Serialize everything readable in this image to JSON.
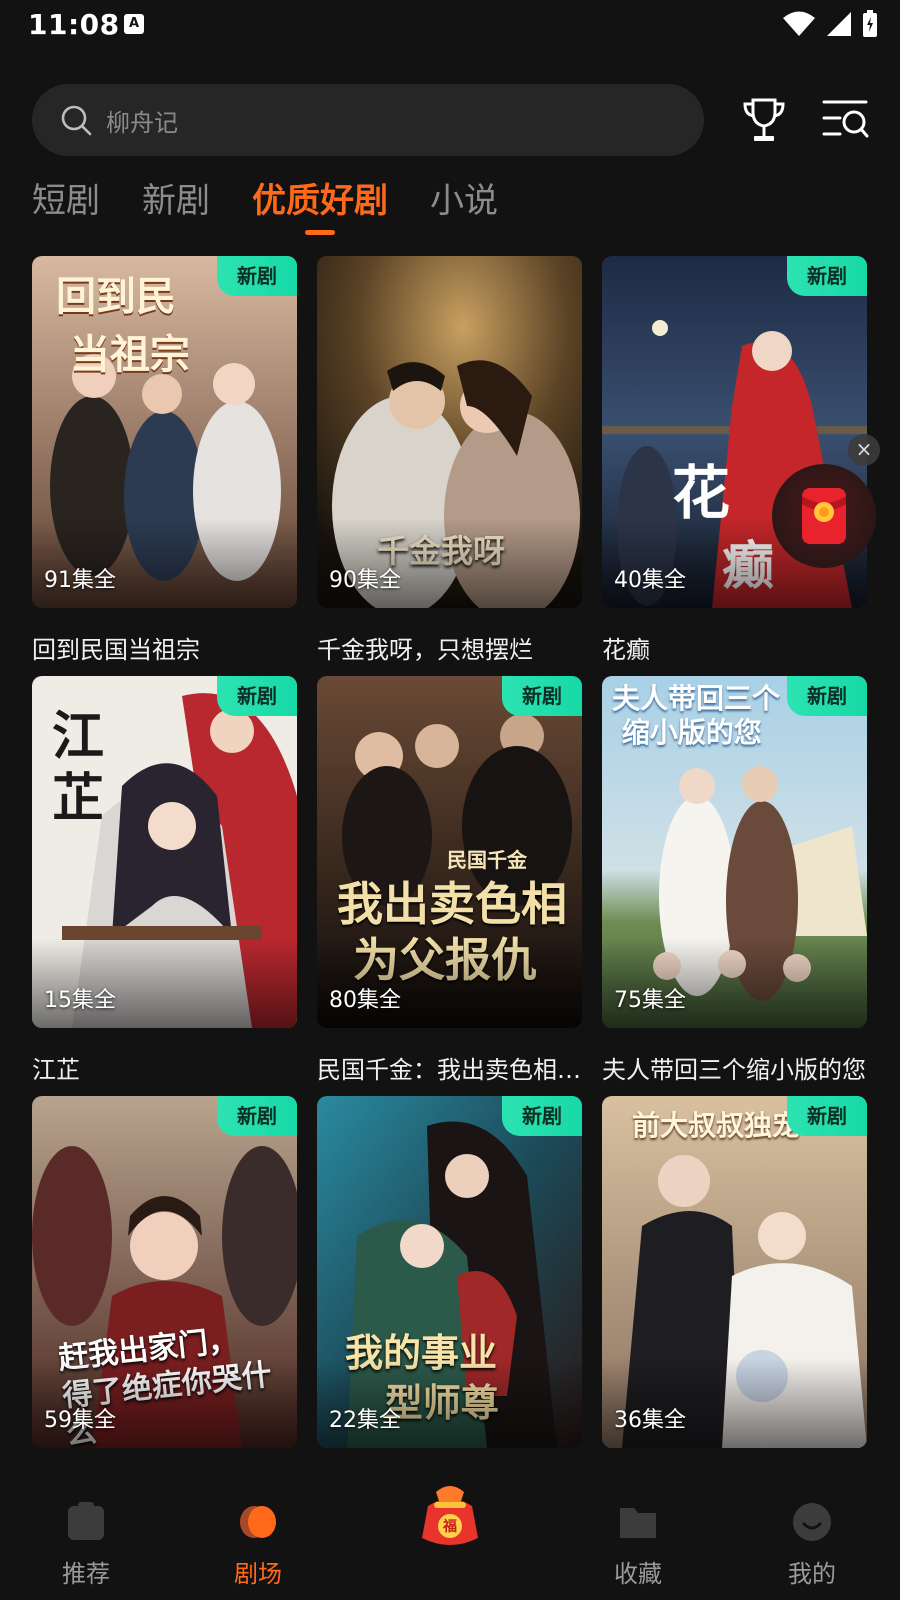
{
  "status_bar": {
    "time": "11:08",
    "a_badge": "A"
  },
  "search": {
    "placeholder": "柳舟记"
  },
  "tabs": [
    {
      "label": "短剧",
      "active": false
    },
    {
      "label": "新剧",
      "active": false
    },
    {
      "label": "优质好剧",
      "active": true
    },
    {
      "label": "小说",
      "active": false
    }
  ],
  "badge_label": "新剧",
  "cards": [
    {
      "title": "回到民国当祖宗",
      "episodes": "91集全",
      "poster_text": "回到民国当祖宗",
      "badge": true,
      "colors": [
        "#c9a48a",
        "#6b4a3a"
      ]
    },
    {
      "title": "千金我呀，只想摆烂",
      "episodes": "90集全",
      "poster_text": "千金我呀 只想摆烂",
      "badge": false,
      "colors": [
        "#5c4425",
        "#1f1810"
      ]
    },
    {
      "title": "花癫",
      "episodes": "40集全",
      "poster_text": "花癫",
      "badge": true,
      "colors": [
        "#2d3a5a",
        "#8a2a2a"
      ]
    },
    {
      "title": "江芷",
      "episodes": "15集全",
      "poster_text": "江芷",
      "badge": true,
      "colors": [
        "#eae6e0",
        "#a8323a"
      ]
    },
    {
      "title": "民国千金：我出卖色相为父报仇",
      "episodes": "80集全",
      "poster_text": "民国千金 我出卖色相 为父报仇",
      "badge": true,
      "colors": [
        "#5a3e2c",
        "#140f0c"
      ]
    },
    {
      "title": "夫人带回三个缩小版的您",
      "episodes": "75集全",
      "poster_text": "夫人带回三个缩小版的您",
      "badge": true,
      "colors": [
        "#9fc4d8",
        "#5a7a4a"
      ]
    },
    {
      "title": "",
      "episodes": "59集全",
      "poster_text": "赶我出家门，得了绝症你哭什么",
      "badge": true,
      "colors": [
        "#b8a08a",
        "#5a2a22"
      ]
    },
    {
      "title": "",
      "episodes": "22集全",
      "poster_text": "我的事业型师尊",
      "badge": true,
      "colors": [
        "#1d5a6a",
        "#2a1a1a"
      ]
    },
    {
      "title": "",
      "episodes": "36集全",
      "poster_text": "前夫叔叔独宠",
      "badge": true,
      "colors": [
        "#c9b090",
        "#3a3030"
      ]
    }
  ],
  "floating": {
    "close_label": "×"
  },
  "nav": [
    {
      "label": "推荐",
      "icon": "tv-icon",
      "active": false
    },
    {
      "label": "剧场",
      "icon": "theater-icon",
      "active": true
    },
    {
      "label": "",
      "icon": "lucky-bag-icon",
      "active": false
    },
    {
      "label": "收藏",
      "icon": "folder-icon",
      "active": false
    },
    {
      "label": "我的",
      "icon": "profile-icon",
      "active": false
    }
  ],
  "colors": {
    "accent": "#ff6a1a",
    "badge": "#22dfac",
    "background": "#121212"
  }
}
